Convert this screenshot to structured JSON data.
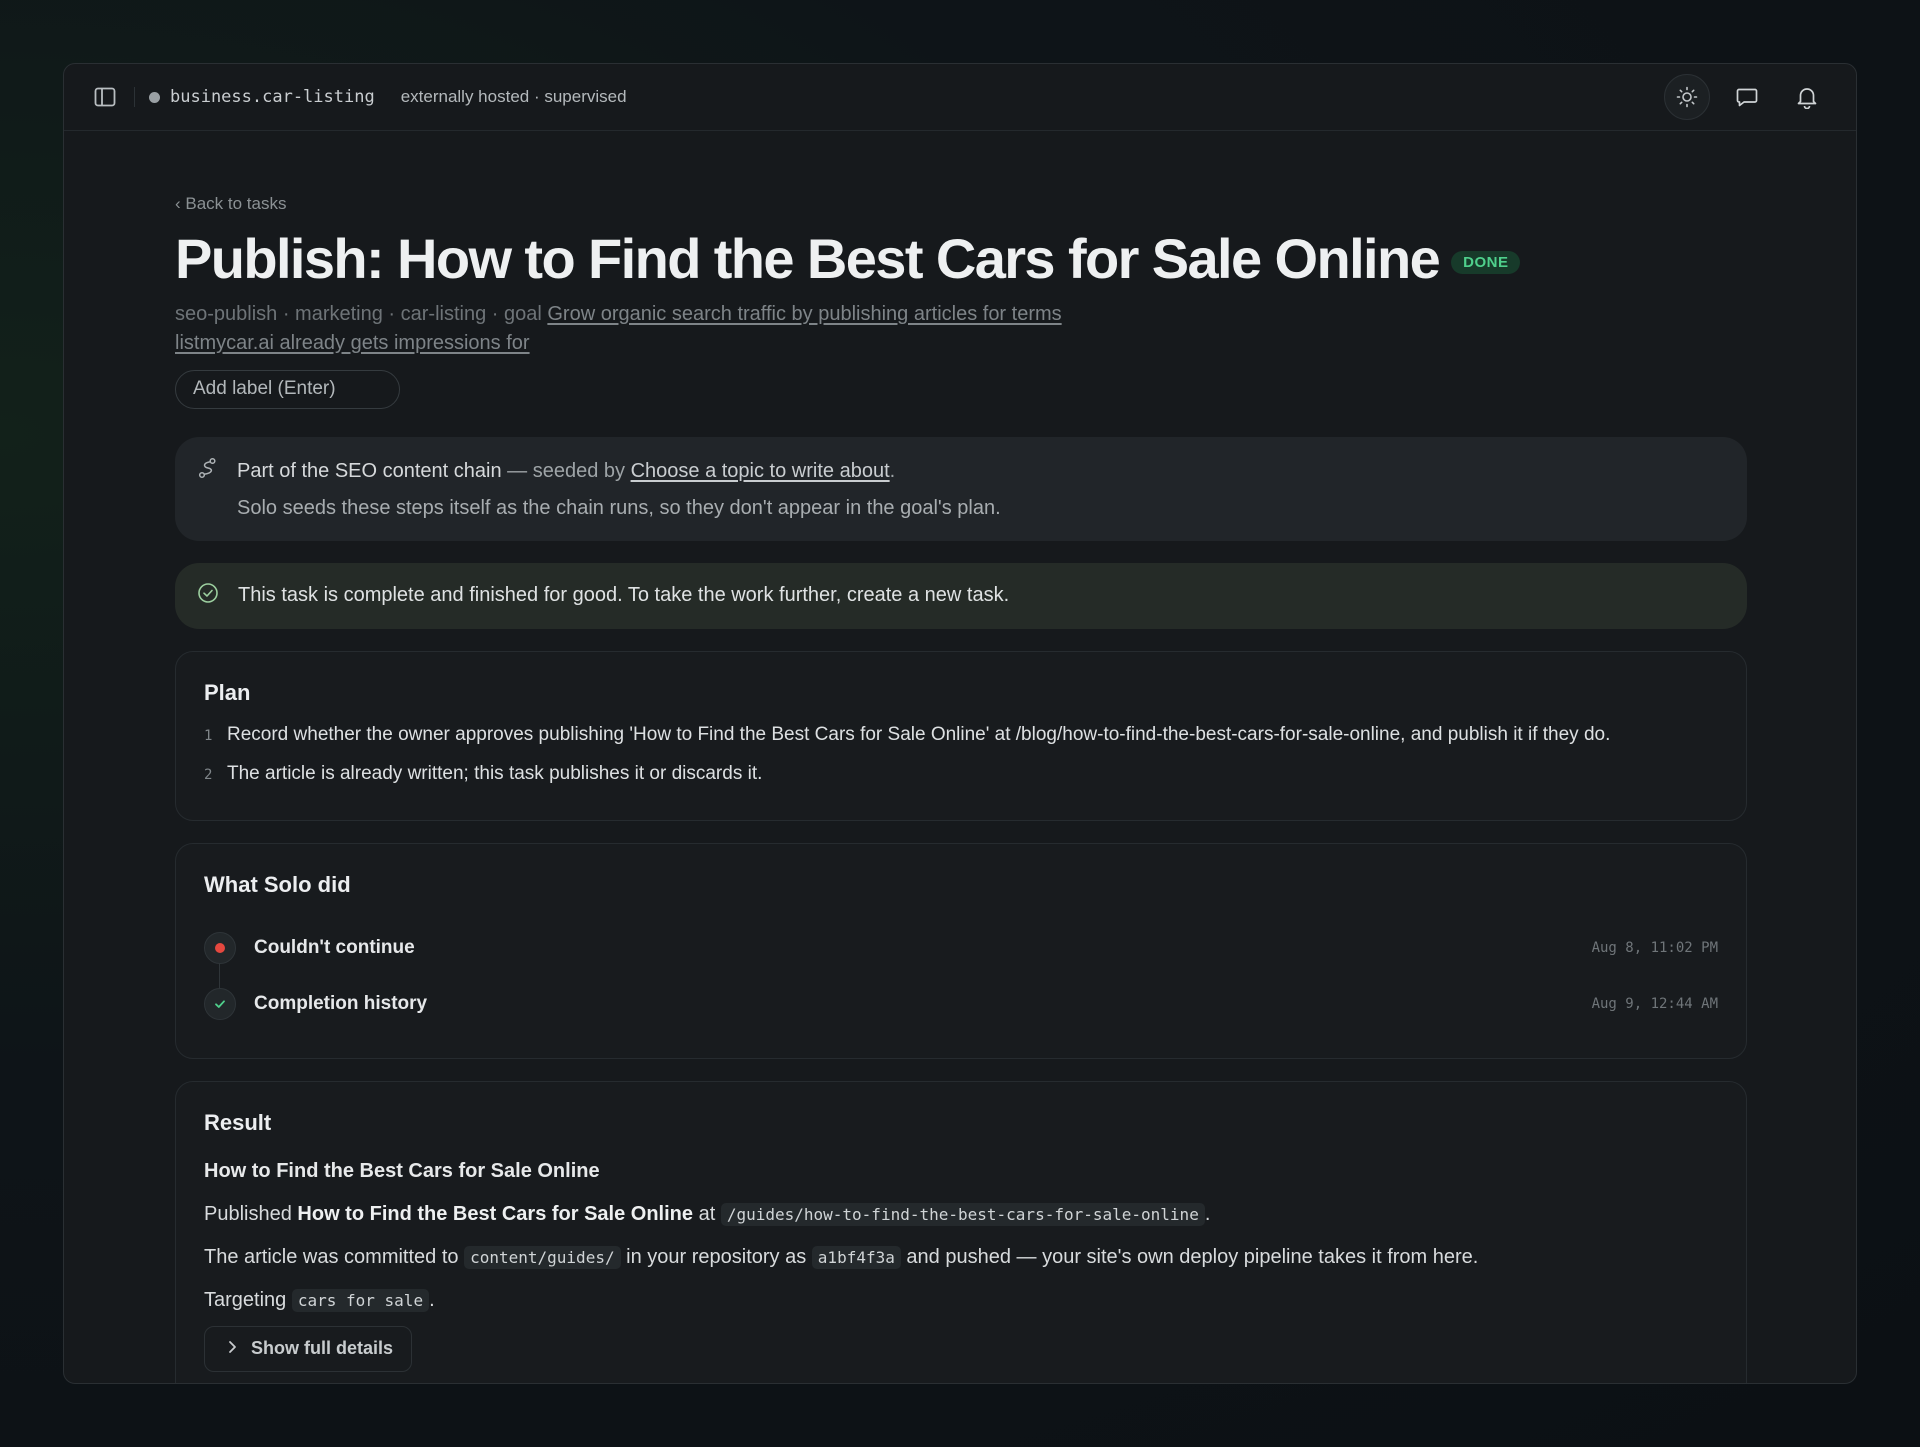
{
  "topbar": {
    "project": "business.car-listing",
    "hosting": "externally hosted · supervised",
    "icons": [
      "sidebar-icon",
      "sun-icon",
      "chat-icon",
      "bell-icon"
    ]
  },
  "task": {
    "back_label": "‹ Back to tasks",
    "title": "Publish: How to Find the Best Cars for Sale Online",
    "status": "DONE",
    "meta_prefix": "seo-publish · marketing · car-listing · goal ",
    "goal_link": "Grow organic search traffic by publishing articles for terms listmycar.ai already gets impressions for",
    "label_placeholder": "Add label (Enter)"
  },
  "chain": {
    "prefix": "Part of the SEO content chain",
    "seeded_by": " — seeded by ",
    "link": "Choose a topic to write about",
    "suffix": ".",
    "note": "Solo seeds these steps itself as the chain runs, so they don't appear in the goal's plan."
  },
  "complete_notice": "This task is complete and finished for good. To take the work further, create a new task.",
  "plan": {
    "heading": "Plan",
    "items": [
      {
        "num": "1",
        "text": "Record whether the owner approves publishing 'How to Find the Best Cars for Sale Online' at /blog/how-to-find-the-best-cars-for-sale-online, and publish it if they do."
      },
      {
        "num": "2",
        "text": "The article is already written; this task publishes it or discards it."
      }
    ]
  },
  "activity": {
    "heading": "What Solo did",
    "events": [
      {
        "label": "Couldn't continue",
        "time": "Aug 8, 11:02 PM",
        "status": "error"
      },
      {
        "label": "Completion history",
        "time": "Aug 9, 12:44 AM",
        "status": "success"
      }
    ]
  },
  "result": {
    "heading": "Result",
    "article_title": "How to Find the Best Cars for Sale Online",
    "published_prefix": "Published ",
    "published_title": "How to Find the Best Cars for Sale Online",
    "published_at": " at ",
    "published_path": "/guides/how-to-find-the-best-cars-for-sale-online",
    "committed_prefix": "The article was committed to ",
    "committed_dir": "content/guides/",
    "committed_mid": " in your repository as ",
    "commit_hash": "a1bf4f3a",
    "committed_suffix": " and pushed — your site's own deploy pipeline takes it from here.",
    "targeting_prefix": "Targeting ",
    "keyword": "cars for sale",
    "show_details": "Show full details"
  },
  "colors": {
    "done_badge": "#4fd08c",
    "error_dot": "#e5483f",
    "success_check": "#4fd08c"
  }
}
